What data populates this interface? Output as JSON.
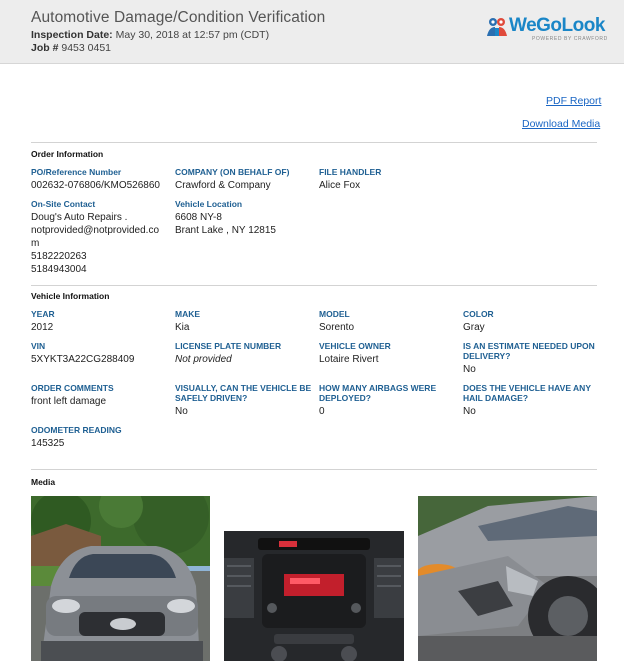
{
  "header": {
    "title": "Automotive Damage/Condition Verification",
    "inspection_date_label": "Inspection Date:",
    "inspection_date": "May 30, 2018 at 12:57 pm (CDT)",
    "job_label": "Job #",
    "job_number": "9453 0451",
    "logo_text": "WeGoLook",
    "logo_sub": "POWERED BY CRAWFORD"
  },
  "links": {
    "pdf_report": "PDF Report",
    "download_media": "Download Media"
  },
  "order": {
    "title": "Order Information",
    "po_label": "PO/Reference Number",
    "po_value": "002632-076806/KMO526860",
    "company_label": "COMPANY (ON BEHALF OF)",
    "company_value": "Crawford & Company",
    "handler_label": "FILE HANDLER",
    "handler_value": "Alice Fox",
    "contact_label": "On-Site Contact",
    "contact_name": "Doug's Auto Repairs .",
    "contact_email_1": "notprovided@notprovided.co",
    "contact_email_2": "m",
    "contact_phone_1": "5182220263",
    "contact_phone_2": "5184943004",
    "location_label": "Vehicle Location",
    "location_line1": "6608 NY-8",
    "location_line2": "Brant Lake , NY 12815"
  },
  "vehicle": {
    "title": "Vehicle Information",
    "year_label": "YEAR",
    "year": "2012",
    "make_label": "MAKE",
    "make": "Kia",
    "model_label": "MODEL",
    "model": "Sorento",
    "color_label": "COLOR",
    "color": "Gray",
    "vin_label": "VIN",
    "vin": "5XYKT3A22CG288409",
    "plate_label": "LICENSE PLATE NUMBER",
    "plate": "Not provided",
    "owner_label": "VEHICLE OWNER",
    "owner": "Lotaire Rivert",
    "estimate_label_1": "IS AN ESTIMATE NEEDED UPON",
    "estimate_label_2": "DELIVERY?",
    "estimate": "No",
    "comments_label": "ORDER COMMENTS",
    "comments": "front left damage",
    "driven_label_1": "VISUALLY, CAN THE VEHICLE BE",
    "driven_label_2": "SAFELY DRIVEN?",
    "driven": "No",
    "airbags_label_1": "HOW MANY AIRBAGS WERE",
    "airbags_label_2": "DEPLOYED?",
    "airbags": "0",
    "hail_label_1": "DOES THE VEHICLE HAVE ANY",
    "hail_label_2": "HAIL DAMAGE?",
    "hail": "No",
    "odometer_label": "ODOMETER READING",
    "odometer": "145325"
  },
  "media": {
    "title": "Media"
  },
  "colors": {
    "accent": "#1e5f92",
    "link": "#1a66c4",
    "brand": "#1a86c7"
  }
}
